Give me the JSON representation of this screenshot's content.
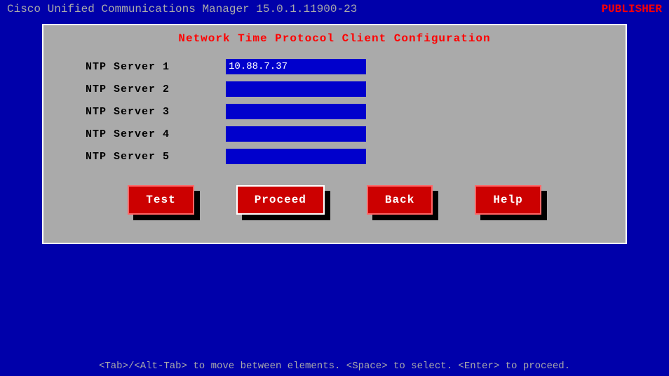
{
  "header": {
    "app_title": "Cisco Unified Communications Manager 15.0.1.11900-23",
    "publisher_label": "PUBLISHER"
  },
  "panel": {
    "title": "Network Time Protocol Client Configuration",
    "ntp_servers": [
      {
        "label": "NTP  Server  1",
        "value": "10.88.7.37",
        "placeholder": ""
      },
      {
        "label": "NTP  Server  2",
        "value": "",
        "placeholder": ""
      },
      {
        "label": "NTP  Server  3",
        "value": "",
        "placeholder": ""
      },
      {
        "label": "NTP  Server  4",
        "value": "",
        "placeholder": ""
      },
      {
        "label": "NTP  Server  5",
        "value": "",
        "placeholder": ""
      }
    ]
  },
  "buttons": [
    {
      "id": "test",
      "label": "Test"
    },
    {
      "id": "proceed",
      "label": "Proceed"
    },
    {
      "id": "back",
      "label": "Back"
    },
    {
      "id": "help",
      "label": "Help"
    }
  ],
  "status_bar": {
    "text": "<Tab>/<Alt-Tab> to move between elements.  <Space> to select.  <Enter> to proceed."
  }
}
